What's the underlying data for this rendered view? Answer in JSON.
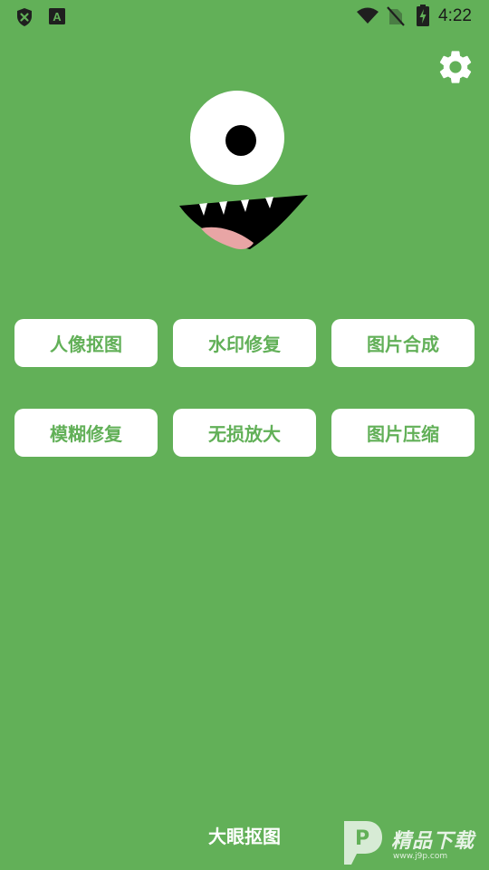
{
  "status_bar": {
    "time": "4:22",
    "left_icons": [
      "shield-x-icon",
      "font-a-icon"
    ],
    "right_icons": [
      "wifi-icon",
      "no-sim-icon",
      "battery-charging-icon"
    ],
    "notification_letter": "A"
  },
  "header": {
    "settings_icon": "gear-icon"
  },
  "features": [
    {
      "label": "人像抠图"
    },
    {
      "label": "水印修复"
    },
    {
      "label": "图片合成"
    },
    {
      "label": "模糊修复"
    },
    {
      "label": "无损放大"
    },
    {
      "label": "图片压缩"
    }
  ],
  "footer": {
    "app_name": "大眼抠图"
  },
  "watermark": {
    "logo_text": "精品下载",
    "url": "www.j9p.com",
    "logo_letter": "P"
  },
  "colors": {
    "background": "#62b058",
    "button_bg": "#ffffff",
    "button_text": "#62b058",
    "mouth": "#000000",
    "tongue": "#e8a5a5"
  }
}
